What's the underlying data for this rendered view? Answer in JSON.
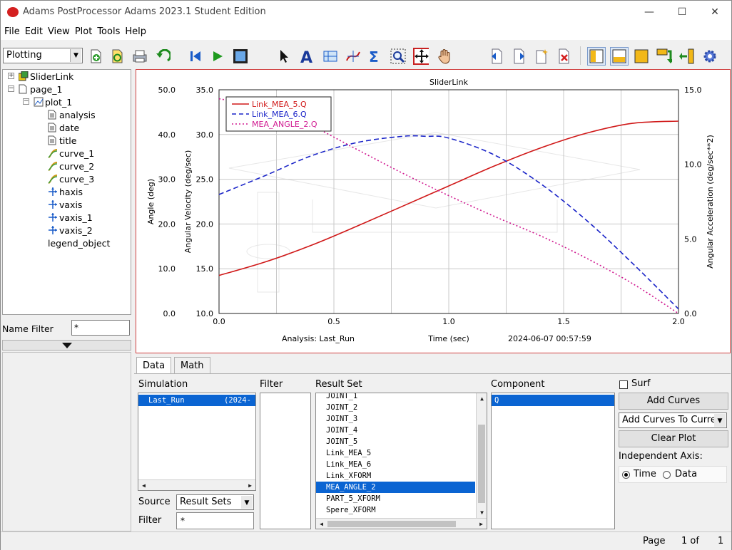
{
  "window": {
    "title": "Adams  PostProcessor Adams 2023.1 Student Edition",
    "minimize_glyph": "—",
    "maximize_glyph": "☐",
    "close_glyph": "✕"
  },
  "menu": [
    "File",
    "Edit",
    "View",
    "Plot",
    "Tools",
    "Help"
  ],
  "toolbar": {
    "mode": "Plotting",
    "icons": [
      "new-page-icon",
      "reload-icon",
      "print-icon",
      "undo-icon",
      "rewind-icon",
      "play-icon",
      "animation-icon",
      "select-arrow-icon",
      "text-icon",
      "axis-icon",
      "curve-edit-icon",
      "sigma-icon",
      "zoom-icon",
      "fit-icon",
      "pan-hand-icon",
      "previous-page-icon",
      "next-page-icon",
      "new-page-icon",
      "delete-page-icon",
      "layout-icon",
      "layout2-icon",
      "fill-icon",
      "swap-icon",
      "import-icon",
      "settings-gear-icon"
    ]
  },
  "tree": {
    "items": [
      {
        "label": "SliderLink"
      },
      {
        "label": "page_1"
      },
      {
        "label": "plot_1"
      },
      {
        "label": "analysis"
      },
      {
        "label": "date"
      },
      {
        "label": "title"
      },
      {
        "label": "curve_1"
      },
      {
        "label": "curve_2"
      },
      {
        "label": "curve_3"
      },
      {
        "label": "haxis"
      },
      {
        "label": "vaxis"
      },
      {
        "label": "vaxis_1"
      },
      {
        "label": "vaxis_2"
      },
      {
        "label": "legend_object"
      }
    ],
    "name_filter_label": "Name Filter",
    "name_filter_value": "*"
  },
  "chart_data": {
    "type": "line",
    "title": "SliderLink",
    "xlabel": "Time (sec)",
    "xlim": [
      0.0,
      2.0
    ],
    "x_ticks": [
      "0.0",
      "0.5",
      "1.0",
      "1.5",
      "2.0"
    ],
    "axes": [
      {
        "label": "Angle (deg)",
        "ylim": [
          0.0,
          50.0
        ],
        "ticks": [
          "50.0",
          "40.0",
          "30.0",
          "20.0",
          "10.0",
          "0.0"
        ]
      },
      {
        "label": "Angular Velocity (deg/sec)",
        "ylim": [
          10.0,
          35.0
        ],
        "ticks": [
          "35.0",
          "30.0",
          "25.0",
          "20.0",
          "15.0",
          "10.0"
        ]
      },
      {
        "label": "Angular Acceleration (deg/sec**2)",
        "ylim": [
          0.0,
          15.0
        ],
        "ticks": [
          "15.0",
          "10.0",
          "5.0",
          "0.0"
        ]
      }
    ],
    "grid": true,
    "legend_position": "top-left",
    "series": [
      {
        "name": "Link_MEA_5.Q",
        "color": "#d01818",
        "dash": "solid",
        "axis": 0,
        "x": [
          0.0,
          0.2,
          0.4,
          0.6,
          0.8,
          1.0,
          1.2,
          1.4,
          1.6,
          1.8,
          2.0
        ],
        "y": [
          8.5,
          11.5,
          15.2,
          19.5,
          24.0,
          28.5,
          33.0,
          37.0,
          40.3,
          42.5,
          43.0
        ]
      },
      {
        "name": "Link_MEA_6.Q",
        "color": "#1a24c8",
        "dash": "dashed",
        "axis": 1,
        "x": [
          0.0,
          0.2,
          0.4,
          0.6,
          0.8,
          0.9,
          1.0,
          1.2,
          1.4,
          1.6,
          1.8,
          2.0
        ],
        "y": [
          23.3,
          25.4,
          27.6,
          29.1,
          29.8,
          29.8,
          29.6,
          27.7,
          24.5,
          20.4,
          15.6,
          10.5
        ]
      },
      {
        "name": "MEA_ANGLE_2.Q",
        "color": "#d01890",
        "dash": "dotted",
        "axis": 2,
        "x": [
          0.0,
          0.2,
          0.4,
          0.6,
          0.8,
          1.0,
          1.2,
          1.4,
          1.6,
          1.8,
          2.0
        ],
        "y": [
          14.4,
          13.8,
          12.6,
          11.0,
          9.4,
          7.9,
          6.5,
          5.2,
          3.7,
          2.0,
          0.0
        ]
      }
    ],
    "footer": {
      "analysis": "Analysis:  Last_Run",
      "timestamp": "2024-06-07 00:57:59"
    }
  },
  "tabs": {
    "data": "Data",
    "math": "Math"
  },
  "simulation": {
    "label": "Simulation",
    "items": [
      {
        "name": "Last_Run",
        "date": "(2024-"
      }
    ]
  },
  "filter_col_label": "Filter",
  "result_set": {
    "label": "Result Set",
    "items": [
      "JOINT_1",
      "JOINT_2",
      "JOINT_3",
      "JOINT_4",
      "JOINT_5",
      "Link_MEA_5",
      "Link_MEA_6",
      "Link_XFORM",
      "MEA_ANGLE_2",
      "PART_5_XFORM",
      "Spere_XFORM"
    ],
    "selected": "MEA_ANGLE_2"
  },
  "component": {
    "label": "Component",
    "items": [
      "Q"
    ]
  },
  "source": {
    "label": "Source",
    "value": "Result Sets"
  },
  "filter": {
    "label": "Filter",
    "value": "*"
  },
  "controls": {
    "surf": "Surf",
    "add_curves": "Add Curves",
    "add_mode": "Add Curves To Current",
    "clear_plot": "Clear Plot",
    "independent_axis": "Independent Axis:",
    "time": "Time",
    "data": "Data"
  },
  "status": {
    "page": "Page",
    "current": "1 of",
    "total": "1"
  }
}
